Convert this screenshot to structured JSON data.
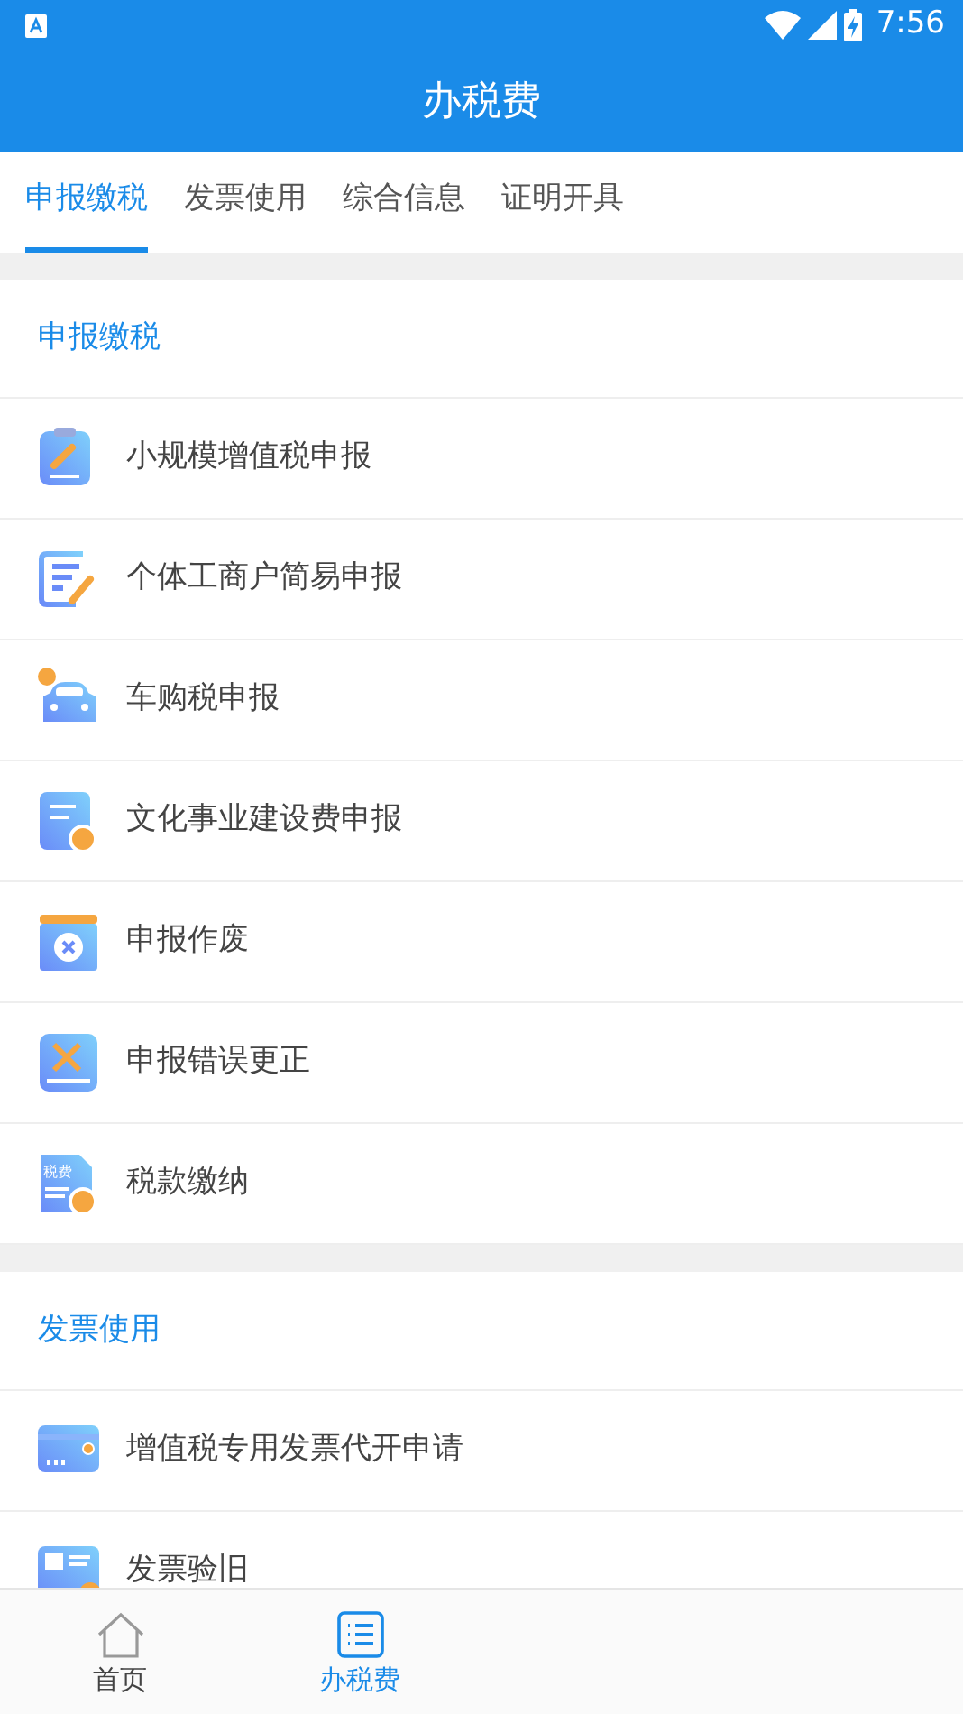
{
  "status_bar": {
    "time": "7:56"
  },
  "header": {
    "title": "办税费"
  },
  "tabs": [
    {
      "label": "申报缴税",
      "selected": true
    },
    {
      "label": "发票使用",
      "selected": false
    },
    {
      "label": "综合信息",
      "selected": false
    },
    {
      "label": "证明开具",
      "selected": false
    }
  ],
  "sections": [
    {
      "title": "申报缴税",
      "items": [
        {
          "label": "小规模增值税申报"
        },
        {
          "label": "个体工商户简易申报"
        },
        {
          "label": "车购税申报"
        },
        {
          "label": "文化事业建设费申报"
        },
        {
          "label": "申报作废"
        },
        {
          "label": "申报错误更正"
        },
        {
          "label": "税款缴纳",
          "icon_text": "税费"
        }
      ]
    },
    {
      "title": "发票使用",
      "items": [
        {
          "label": "增值税专用发票代开申请"
        },
        {
          "label": "发票验旧"
        }
      ]
    }
  ],
  "bottom_nav": [
    {
      "label": "首页",
      "selected": false
    },
    {
      "label": "办税费",
      "selected": true
    }
  ]
}
